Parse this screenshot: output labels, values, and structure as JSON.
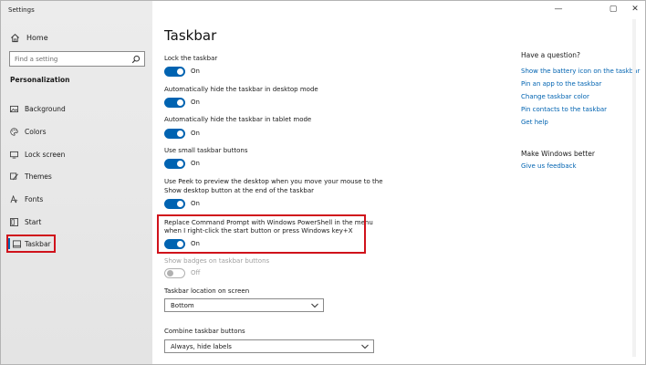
{
  "window": {
    "app_title": "Settings",
    "controls": {
      "minimize": "—",
      "maximize": "▢",
      "close": "✕"
    }
  },
  "sidebar": {
    "home_label": "Home",
    "search_placeholder": "Find a setting",
    "section_header": "Personalization",
    "items": [
      {
        "label": "Background",
        "icon": "image-icon",
        "active": false
      },
      {
        "label": "Colors",
        "icon": "palette-icon",
        "active": false
      },
      {
        "label": "Lock screen",
        "icon": "monitor-icon",
        "active": false
      },
      {
        "label": "Themes",
        "icon": "brush-icon",
        "active": false
      },
      {
        "label": "Fonts",
        "icon": "font-icon",
        "active": false
      },
      {
        "label": "Start",
        "icon": "start-icon",
        "active": false
      },
      {
        "label": "Taskbar",
        "icon": "taskbar-icon",
        "active": true
      }
    ]
  },
  "main": {
    "title": "Taskbar",
    "settings": [
      {
        "label": "Lock the taskbar",
        "state": "On",
        "enabled": true,
        "on": true
      },
      {
        "label": "Automatically hide the taskbar in desktop mode",
        "state": "On",
        "enabled": true,
        "on": true
      },
      {
        "label": "Automatically hide the taskbar in tablet mode",
        "state": "On",
        "enabled": true,
        "on": true
      },
      {
        "label": "Use small taskbar buttons",
        "state": "On",
        "enabled": true,
        "on": true
      },
      {
        "label_line1": "Use Peek to preview the desktop when you move your mouse to the",
        "label_line2": "Show desktop button at the end of the taskbar",
        "state": "On",
        "enabled": true,
        "on": true
      },
      {
        "label_line1": "Replace Command Prompt with Windows PowerShell in the menu",
        "label_line2": "when I right-click the start button or press Windows key+X",
        "state": "On",
        "enabled": true,
        "on": true
      },
      {
        "label": "Show badges on taskbar buttons",
        "state": "Off",
        "enabled": false,
        "on": false
      }
    ],
    "location": {
      "label": "Taskbar location on screen",
      "value": "Bottom"
    },
    "combine": {
      "label": "Combine taskbar buttons",
      "value": "Always, hide labels"
    }
  },
  "right": {
    "question_header": "Have a question?",
    "links": [
      "Show the battery icon on the taskbar",
      "Pin an app to the taskbar",
      "Change taskbar color",
      "Pin contacts to the taskbar",
      "Get help"
    ],
    "better_header": "Make Windows better",
    "feedback_link": "Give us feedback"
  },
  "colors": {
    "accent": "#0063b1",
    "highlight": "#d0121b"
  }
}
